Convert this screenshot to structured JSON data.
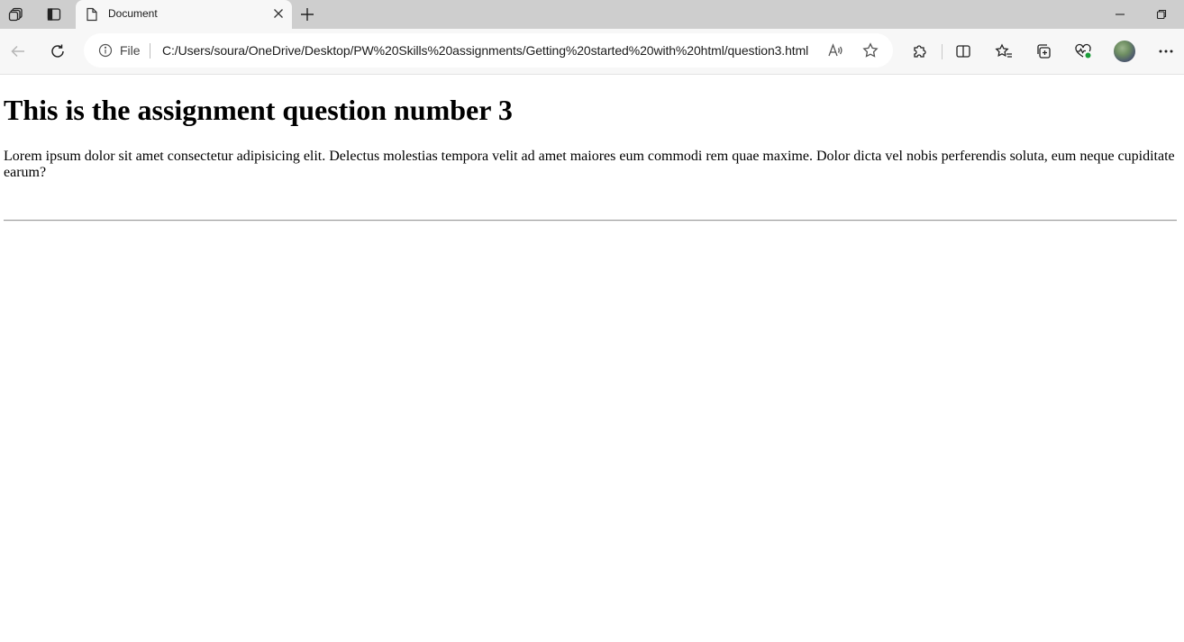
{
  "browser": {
    "tab": {
      "title": "Document"
    },
    "address_bar": {
      "scheme_label": "File",
      "url": "C:/Users/soura/OneDrive/Desktop/PW%20Skills%20assignments/Getting%20started%20with%20html/question3.html"
    },
    "icons": {
      "workspaces": "workspaces-icon",
      "tab_actions": "tab-actions-icon",
      "page": "page-icon",
      "close_tab": "close-icon",
      "new_tab": "plus-icon",
      "minimize": "minimize-icon",
      "restore": "restore-icon",
      "back": "back-arrow-icon",
      "refresh": "refresh-icon",
      "site_info": "info-icon",
      "read_aloud": "read-aloud-icon",
      "favorite": "star-icon",
      "extensions": "puzzle-icon",
      "split_screen": "split-screen-icon",
      "favorites": "favorites-icon",
      "collections": "collections-icon",
      "performance": "heartbeat-icon",
      "profile": "avatar",
      "more": "more-icon"
    }
  },
  "page": {
    "heading": "This is the assignment question number 3",
    "paragraph": "Lorem ipsum dolor sit amet consectetur adipisicing elit. Delectus molestias tempora velit ad amet maiores eum commodi rem quae maxime. Dolor dicta vel nobis perferendis soluta, eum neque cupiditate earum?"
  }
}
